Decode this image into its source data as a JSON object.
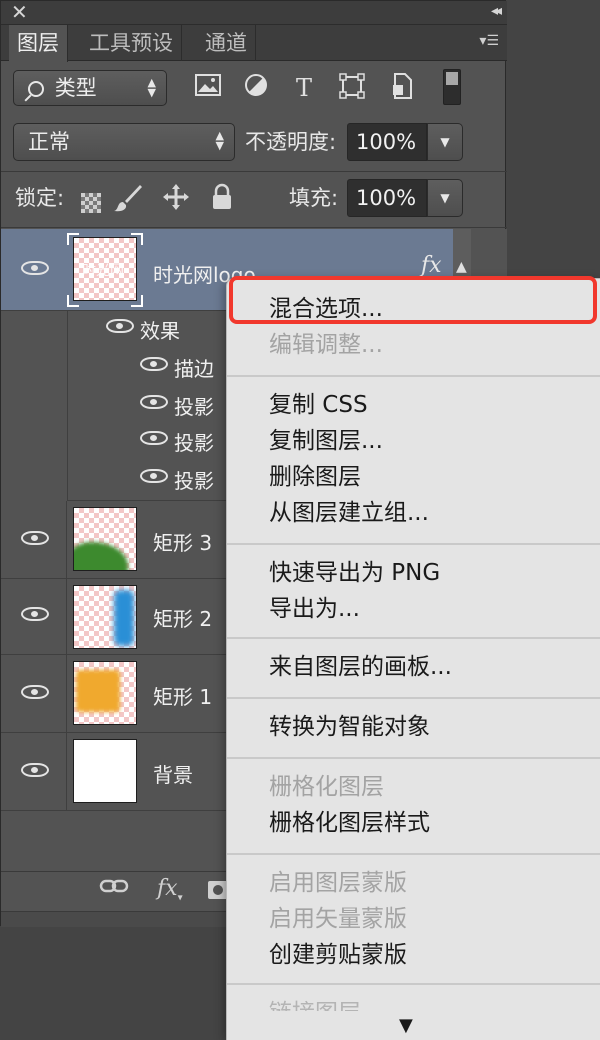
{
  "window": {
    "close_glyph": "✕",
    "collapse_glyph": "◂◂"
  },
  "tabs": [
    {
      "label": "图层",
      "active": true
    },
    {
      "label": "工具预设",
      "active": false
    },
    {
      "label": "通道",
      "active": false
    }
  ],
  "tab_menu_glyph": "▾☰",
  "filter": {
    "label": "类型",
    "icons": [
      "image-filter-icon",
      "adjustment-filter-icon",
      "type-filter-icon",
      "shape-filter-icon",
      "smart-object-filter-icon"
    ]
  },
  "blend": {
    "mode": "正常",
    "opacity_label": "不透明度:",
    "opacity_value": "100%"
  },
  "lock": {
    "label": "锁定:",
    "fill_label": "填充:",
    "fill_value": "100%"
  },
  "layers": [
    {
      "name": "时光网logo",
      "thumb_text": "时光网",
      "selected": true,
      "has_fx": true,
      "effects_label": "效果",
      "effects": [
        "描边",
        "投影",
        "投影",
        "投影"
      ]
    },
    {
      "name": "矩形 3",
      "thumb": "green-blob"
    },
    {
      "name": "矩形 2",
      "thumb": "blue-streak"
    },
    {
      "name": "矩形 1",
      "thumb": "orange-square"
    },
    {
      "name": "背景",
      "thumb": "white"
    }
  ],
  "fx_badge": "fx",
  "bottom_icons": [
    "link-icon",
    "fx-icon",
    "mask-icon"
  ],
  "context_menu": {
    "groups": [
      [
        {
          "label": "混合选项...",
          "enabled": true,
          "highlighted": true
        },
        {
          "label": "编辑调整...",
          "enabled": false
        }
      ],
      [
        {
          "label": "复制 CSS",
          "enabled": true
        },
        {
          "label": "复制图层...",
          "enabled": true
        },
        {
          "label": "删除图层",
          "enabled": true
        },
        {
          "label": "从图层建立组...",
          "enabled": true
        }
      ],
      [
        {
          "label": "快速导出为 PNG",
          "enabled": true
        },
        {
          "label": "导出为...",
          "enabled": true
        }
      ],
      [
        {
          "label": "来自图层的画板...",
          "enabled": true
        }
      ],
      [
        {
          "label": "转换为智能对象",
          "enabled": true
        }
      ],
      [
        {
          "label": "栅格化图层",
          "enabled": false
        },
        {
          "label": "栅格化图层样式",
          "enabled": true
        }
      ],
      [
        {
          "label": "启用图层蒙版",
          "enabled": false
        },
        {
          "label": "启用矢量蒙版",
          "enabled": false
        },
        {
          "label": "创建剪贴蒙版",
          "enabled": true
        }
      ]
    ],
    "partial_item": "链接图层",
    "scroll_glyph": "▼"
  },
  "colors": {
    "highlight_box": "#f1382d",
    "selected_row": "#6b7a92",
    "panel_bg": "#535353"
  }
}
